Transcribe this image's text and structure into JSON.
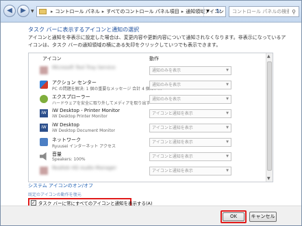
{
  "addressbar": {
    "back_glyph": "◀",
    "fwd_glyph": "▶",
    "crumbs": [
      "コントロール パネル",
      "すべてのコントロール パネル項目",
      "通知領域アイコン"
    ],
    "sep": "▸",
    "search_placeholder": "コントロール パネルの検索"
  },
  "content": {
    "heading": "タスク バーに表示するアイコンと通知の選択",
    "description": "アイコンと通知を非表示に設定した場合は、変更内容や更新内容について通知されなくなります。非表示になっているアイコンは、タスク バーの通知領域の横にある矢印をクリックしていつでも表示できます。",
    "col_icon": "アイコン",
    "col_behavior": "動作",
    "rows": [
      {
        "name": "Microsoft Tool Tray Service",
        "sub": "",
        "behavior": "通知のみを表示",
        "icon": "blurred-icon",
        "blurred": true
      },
      {
        "name": "アクション センター",
        "sub": "PC の問題を解決: 1 個の重要なメッセージ 合計 4 個のメ...",
        "behavior": "通知のみを表示",
        "icon": "flag-icon",
        "blurred": false
      },
      {
        "name": "エクスプローラー",
        "sub": "ハードウェアを安全に取り外してメディアを取り出す",
        "behavior": "通知のみを表示",
        "icon": "eject-icon",
        "blurred": false
      },
      {
        "name": "iW Desktop - Printer Monitor",
        "sub": "iW Desktop Printer Monitor",
        "behavior": "アイコンと通知を表示",
        "icon": "iw-icon",
        "blurred": false
      },
      {
        "name": "iW Desktop",
        "sub": "iW Desktop Document Monitor",
        "behavior": "アイコンと通知を表示",
        "icon": "iw-icon",
        "blurred": false
      },
      {
        "name": "ネットワーク",
        "sub": "Ryuusei インターネット アクセス",
        "behavior": "アイコンと通知を表示",
        "icon": "net-icon",
        "blurred": false
      },
      {
        "name": "音量",
        "sub": "Speakers: 100%",
        "behavior": "アイコンと通知を表示",
        "icon": "vol-icon",
        "blurred": false
      },
      {
        "name": "Realtek HD Audio Manager",
        "sub": "",
        "behavior": "アイコンと通知を表示",
        "icon": "blurred-icon",
        "blurred": true
      }
    ],
    "select_caret": "▼",
    "system_icons_link": "システム アイコンのオン/オフ",
    "restore_link": "既定のアイコンの動作を復元",
    "always_show_label": "タスク バーに常にすべてのアイコンと通知を表示する(A)",
    "checkbox_glyph": "✓"
  },
  "footer": {
    "ok_label": "OK",
    "cancel_label": "キャンセル"
  },
  "colors": {
    "highlight": "#e01818",
    "link": "#1e5fb3"
  }
}
